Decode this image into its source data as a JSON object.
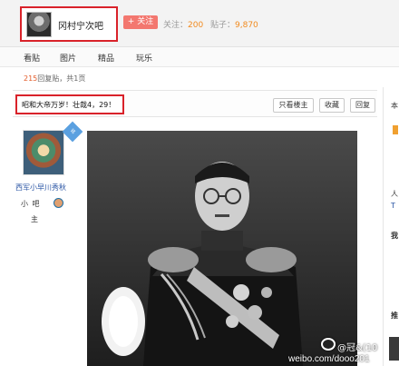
{
  "header": {
    "forum_name": "冈村宁次吧",
    "follow_label": "+ 关注",
    "follow_stat_label": "关注：",
    "follow_stat_value": "200",
    "posts_stat_label": "贴子：",
    "posts_stat_value": "9,870"
  },
  "tabs": [
    "看贴",
    "图片",
    "精品",
    "玩乐"
  ],
  "reply_info": {
    "count": "215",
    "suffix": "回复贴，共1页"
  },
  "post": {
    "title": "昭和大帝万岁！壮哉4，29！",
    "buttons": [
      "只看楼主",
      "收藏",
      "回复"
    ]
  },
  "author": {
    "name": "西军小早川秀秋",
    "role": "小 吧",
    "role_line2": "主",
    "corner_tag": "铭"
  },
  "right_col": {
    "texts": [
      "本",
      "人",
      "T",
      "我",
      "推"
    ]
  },
  "watermark": {
    "user": "@冠&(10",
    "site": "weibo.com/dooo201"
  },
  "colors": {
    "highlight_box": "#d9222a",
    "follow_button": "#f3776f",
    "stat_number": "#f28a1e",
    "username_link": "#2a55a4"
  }
}
